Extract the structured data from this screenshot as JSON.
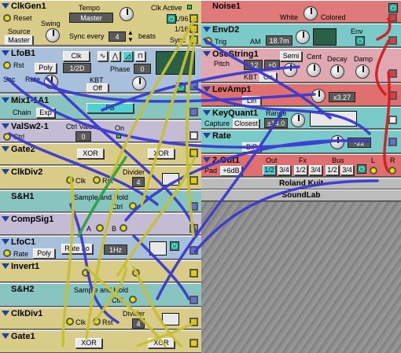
{
  "colors": {
    "cable_blue": "#3a3ad0",
    "cable_yellow": "#c8c030",
    "cable_red": "#d02020",
    "mod_control_yellow": "#d8cc88",
    "mod_logic_purple": "#c4bcd4",
    "mod_audio_teal": "#88c4c0",
    "mod_lfo_blue": "#a8c0dc",
    "mod_noise_red": "#e07a7a",
    "mod_env_cyan": "#7acaca",
    "mod_out_red": "#e07070",
    "mod_osc_pink": "#e0a8b0"
  },
  "left_modules": {
    "clkgen": {
      "title": "ClkGen1",
      "reset": "Reset",
      "source": "Source",
      "master_btn": "Master",
      "swing": "Swing",
      "tempo": "Tempo",
      "tempo_val": "Master",
      "clk_active": "Clk Active",
      "div96": "1/96",
      "div16": "1/16",
      "sync": "Sync",
      "sync_every": "Sync every",
      "sync_val": "4",
      "beats": "beats"
    },
    "lfob": {
      "title": "LfoB1",
      "rst": "Rst",
      "clk_btn": "Clk",
      "poly_btn": "Poly",
      "rate_val": "1/2D",
      "phase": "Phase",
      "phase_val": "0",
      "snc": "Snc",
      "rate": "Rate",
      "kbt": "KBT",
      "kbt_val": "Off"
    },
    "mix": {
      "title": "Mix1-1A1",
      "chain": "Chain",
      "exp_btn": "Exp",
      "fb_val": "FB"
    },
    "valsw": {
      "title": "ValSw2-1",
      "ctrl_value": "Ctrl Value",
      "on_lbl": "On",
      "ctrl": "Ctrl",
      "val0": "0"
    },
    "gate2": {
      "title": "Gate2",
      "op1": "XOR",
      "op2": "XOR"
    },
    "clkdiv2": {
      "title": "ClkDiv2",
      "clk": "Clk",
      "rst": "Rst",
      "divider": "Divider",
      "div_val": "4"
    },
    "sh1": {
      "title": "S&H1",
      "desc": "Sample and Hold",
      "ctrl": "Ctrl"
    },
    "compsig": {
      "title": "CompSig1",
      "a": "A",
      "b": "B"
    },
    "lfoc": {
      "title": "LfoC1",
      "rate": "Rate",
      "poly_btn": "Poly",
      "rate_lo": "Rate Lo",
      "rate_val": "1Hz"
    },
    "invert": {
      "title": "Invert1"
    },
    "sh2": {
      "title": "S&H2",
      "desc": "Sample and Hold",
      "ctrl": "Ctrl"
    },
    "clkdiv1": {
      "title": "ClkDiv1",
      "clk": "Clk",
      "rst": "Rst",
      "divider": "Divider",
      "div_val": "4"
    },
    "gate1": {
      "title": "Gate1",
      "op1": "XOR",
      "op2": "XOR"
    }
  },
  "right_modules": {
    "noise": {
      "title": "Noise1",
      "white": "White",
      "colored": "Colored"
    },
    "envd": {
      "title": "EnvD2",
      "trig": "Trig",
      "am": "AM",
      "time_val": "18.7m",
      "env": "Env"
    },
    "osc": {
      "title": "OscString1",
      "pitch": "Pitch",
      "pitch_val": "-12",
      "fine_val": "+0",
      "semi_btn": "Semi",
      "cent": "Cent",
      "decay": "Decay",
      "damp": "Damp",
      "kbt": "KBT",
      "kbt_val": "On"
    },
    "levamp": {
      "title": "LevAmp1",
      "lin_btn": "Lin",
      "gain_val": "x3.27"
    },
    "keyquant": {
      "title": "KeyQuant1",
      "range": "Range",
      "capture": "Capture",
      "closest_btn": "Closest",
      "range_val": "±14.0"
    },
    "rate": {
      "title": "Rate",
      "bip_btn": "BiP",
      "rate_val": "-22"
    },
    "out": {
      "title": "2-Out1",
      "out": "Out",
      "fx": "Fx",
      "bus": "Bus",
      "pad": "Pad",
      "pad_val": "+6dB",
      "l": "L",
      "r": "R",
      "ch_out": "1/2",
      "ch_out2": "3/4",
      "ch_fx": "1/2",
      "ch_fx2": "3/4",
      "ch_bus": "1/2",
      "ch_bus2": "3/4"
    }
  },
  "footer": {
    "author": "Roland Kuit",
    "lab": "SoundLab"
  }
}
